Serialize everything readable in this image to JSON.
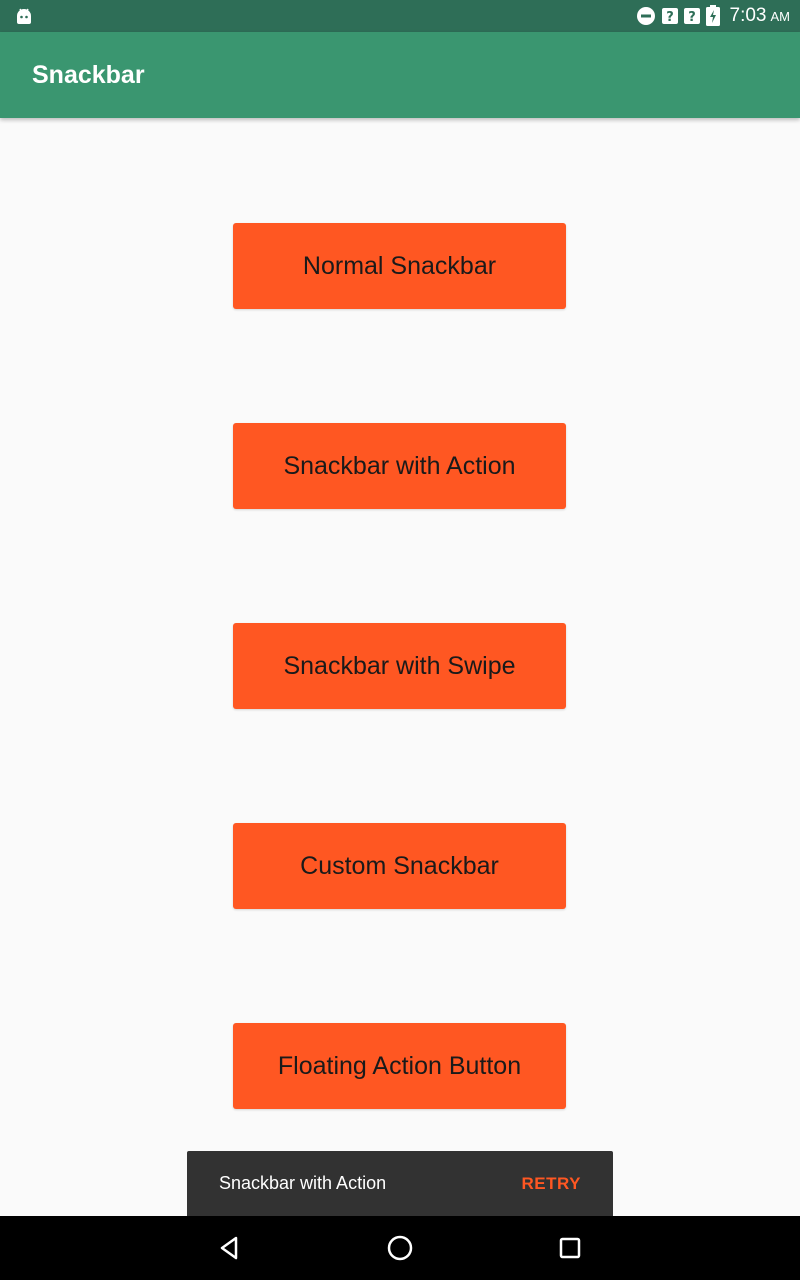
{
  "status_bar": {
    "time": "7:03",
    "ampm": "AM",
    "icons": [
      "android-icon",
      "do-not-disturb-icon",
      "wifi-unknown-icon",
      "signal-unknown-icon",
      "battery-charging-icon"
    ]
  },
  "app_bar": {
    "title": "Snackbar"
  },
  "buttons": [
    {
      "label": "Normal Snackbar"
    },
    {
      "label": "Snackbar with Action"
    },
    {
      "label": "Snackbar with Swipe"
    },
    {
      "label": "Custom Snackbar"
    },
    {
      "label": "Floating Action Button"
    }
  ],
  "snackbar": {
    "message": "Snackbar with Action",
    "action": "RETRY"
  },
  "nav_bar": {
    "icons": [
      "back-icon",
      "home-icon",
      "recents-icon"
    ]
  },
  "colors": {
    "status_bar": "#2e6e57",
    "app_bar": "#3a9670",
    "button": "#ff5722",
    "snackbar": "#323232",
    "snackbar_action": "#ff5722"
  }
}
